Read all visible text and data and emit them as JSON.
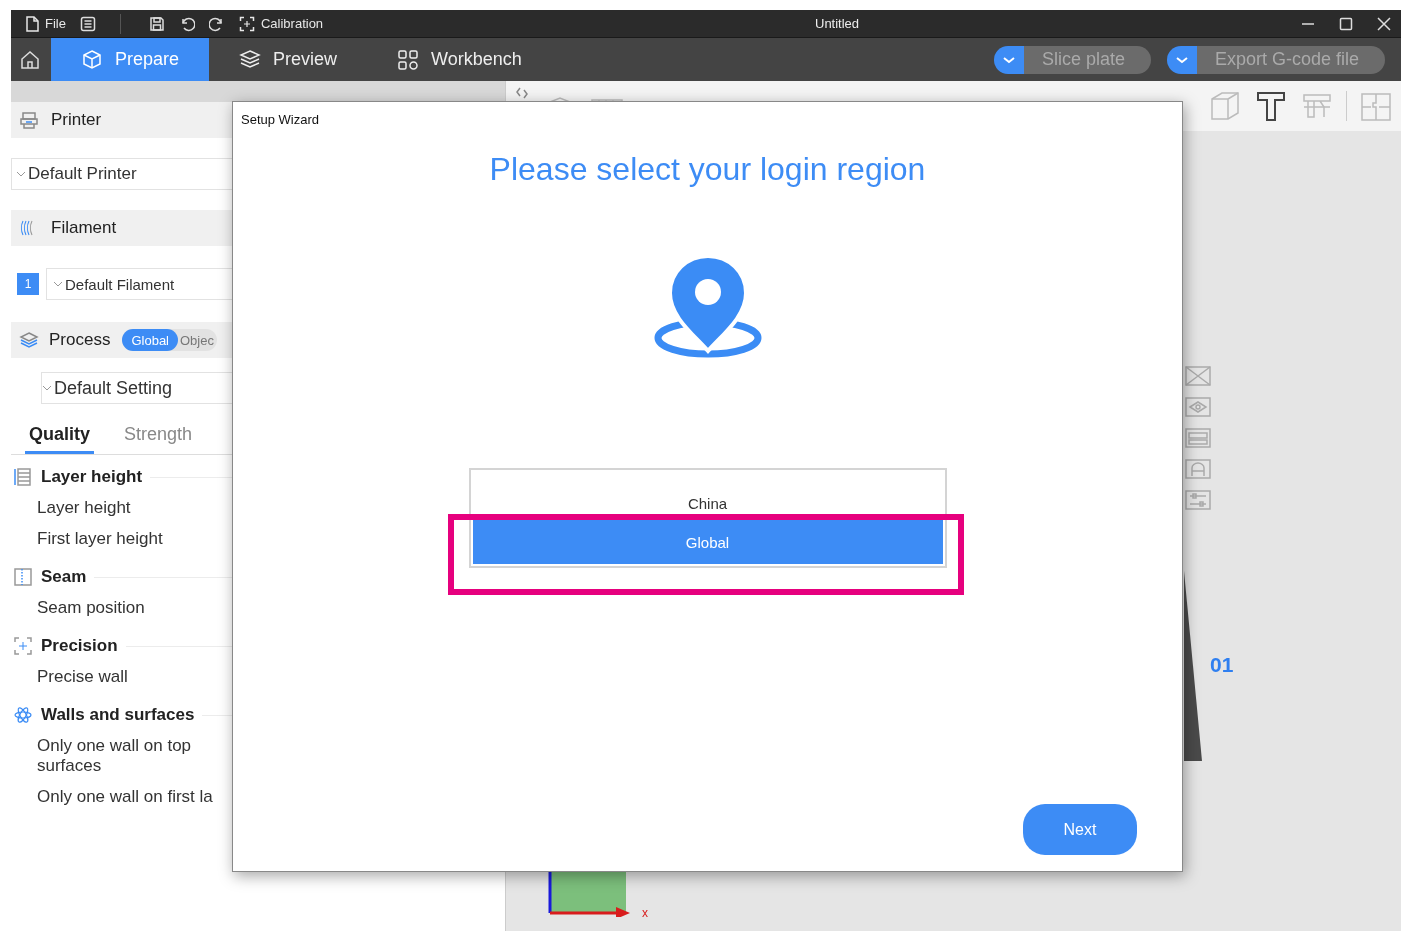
{
  "title_bar": {
    "menu": [
      {
        "label": "File"
      },
      {
        "label": "Calibration"
      }
    ],
    "title": "Untitled"
  },
  "tabs": [
    {
      "label": "Prepare",
      "selected": true
    },
    {
      "label": "Preview",
      "selected": false
    },
    {
      "label": "Workbench",
      "selected": false
    }
  ],
  "actions": [
    {
      "label": "Slice plate"
    },
    {
      "label": "Export G-code file"
    }
  ],
  "sidebar": {
    "printer": {
      "title": "Printer",
      "preset": "Default Printer"
    },
    "filament": {
      "title": "Filament",
      "slot": "1",
      "preset": "Default Filament"
    },
    "process": {
      "title": "Process",
      "scope": [
        {
          "label": "Global",
          "selected": true
        },
        {
          "label": "Objec",
          "selected": false
        }
      ],
      "preset": "Default Setting"
    },
    "tabs": [
      {
        "label": "Quality",
        "selected": true
      },
      {
        "label": "Strength",
        "selected": false
      }
    ],
    "groups": [
      {
        "title": "Layer height",
        "items": [
          "Layer height",
          "First layer height"
        ]
      },
      {
        "title": "Seam",
        "items": [
          "Seam position"
        ]
      },
      {
        "title": "Precision",
        "items": [
          "Precise wall"
        ]
      },
      {
        "title": "Walls and surfaces",
        "items": [
          "Only one wall on top surfaces",
          "Only one wall on first la"
        ]
      }
    ]
  },
  "canvas": {
    "plate_label": "01",
    "axis_label": "x"
  },
  "dialog": {
    "title": "Setup Wizard",
    "heading": "Please select your login region",
    "options": [
      {
        "label": "China",
        "selected": false
      },
      {
        "label": "Global",
        "selected": true
      }
    ],
    "next": "Next"
  }
}
